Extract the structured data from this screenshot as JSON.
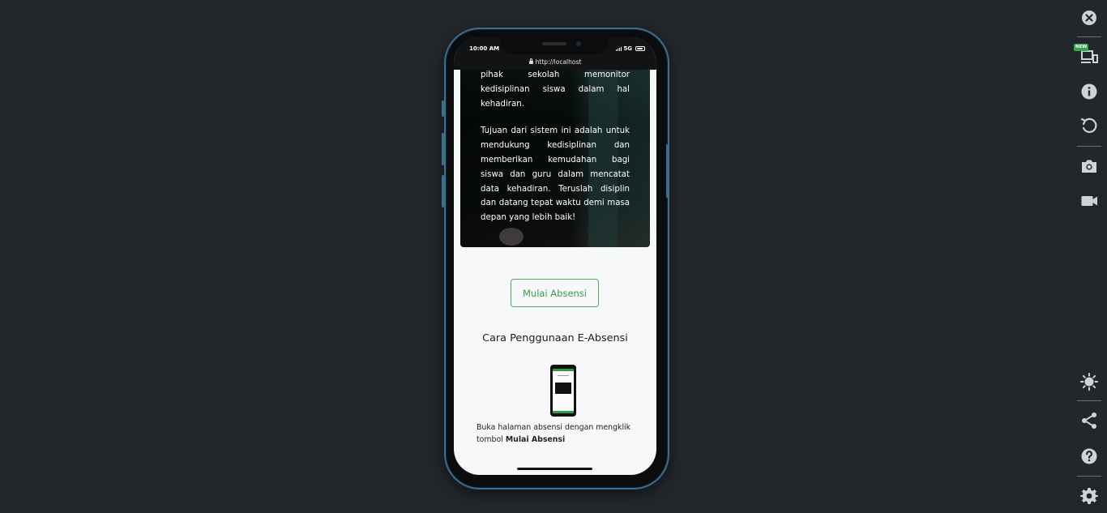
{
  "phone": {
    "status_time": "10:00 AM",
    "network": "5G",
    "url": "http://localhost"
  },
  "hero": {
    "paragraph1": "pihak sekolah memonitor kedisiplinan siswa dalam hal kehadiran.",
    "paragraph2": "Tujuan dari sistem ini adalah untuk mendukung kedisiplinan dan memberikan kemudahan bagi siswa dan guru dalam mencatat data kehadiran. Teruslah disiplin dan datang tepat waktu demi masa depan yang lebih baik!"
  },
  "content": {
    "start_button": "Mulai Absensi",
    "section_title": "Cara Penggunaan E-Absensi",
    "step1_text": "Buka halaman absensi dengan mengklik tombol ",
    "step1_bold": "Mulai Absensi"
  },
  "toolbar": {
    "new_badge": "NEW",
    "icons": [
      "close-icon",
      "devices-icon",
      "info-icon",
      "rotate-icon",
      "camera-icon",
      "video-icon",
      "brightness-icon",
      "share-icon",
      "help-icon",
      "settings-icon"
    ]
  },
  "colors": {
    "background": "#23272b",
    "accent_green": "#3b9b4d",
    "phone_frame": "#3d6f8c"
  }
}
